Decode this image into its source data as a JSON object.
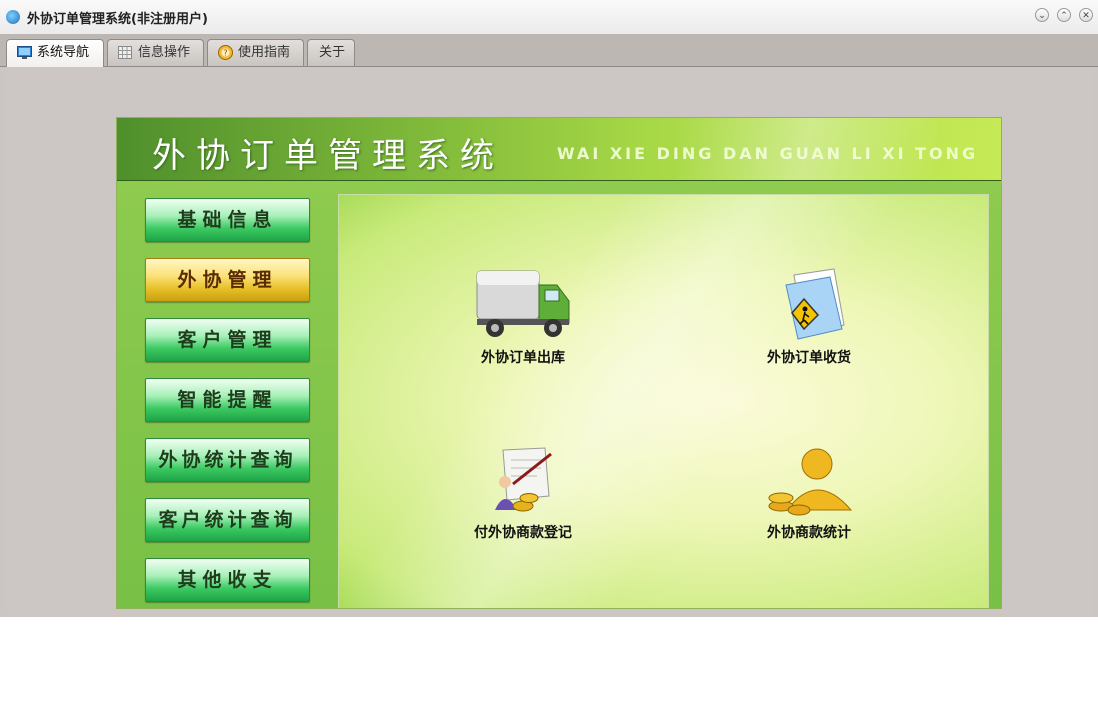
{
  "window": {
    "title": "外协订单管理系统(非注册用户)",
    "controls": [
      "minimize",
      "maximize",
      "close"
    ]
  },
  "tabs": [
    {
      "label": "系统导航",
      "icon": "monitor-icon",
      "active": true
    },
    {
      "label": "信息操作",
      "icon": "grid-icon",
      "active": false
    },
    {
      "label": "使用指南",
      "icon": "help-icon",
      "active": false
    },
    {
      "label": "关于",
      "icon": "",
      "active": false
    }
  ],
  "banner": {
    "title": "外协订单管理系统",
    "subtitle": "WAI XIE DING DAN GUAN LI XI TONG"
  },
  "nav": {
    "items": [
      {
        "label": "基础信息",
        "active": false
      },
      {
        "label": "外协管理",
        "active": true
      },
      {
        "label": "客户管理",
        "active": false
      },
      {
        "label": "智能提醒",
        "active": false
      },
      {
        "label": "外协统计查询",
        "active": false
      },
      {
        "label": "客户统计查询",
        "active": false
      },
      {
        "label": "其他收支",
        "active": false
      }
    ]
  },
  "features": [
    {
      "label": "外协订单出库",
      "icon": "truck-icon"
    },
    {
      "label": "外协订单收货",
      "icon": "folder-icon"
    },
    {
      "label": "付外协商款登记",
      "icon": "payment-chart-icon"
    },
    {
      "label": "外协商款统计",
      "icon": "money-user-icon"
    }
  ],
  "colors": {
    "banner_green": "#79b438",
    "nav_green": "#3cc961",
    "nav_active_gold": "#e7c02a",
    "window_bg": "#cbc6c3"
  }
}
